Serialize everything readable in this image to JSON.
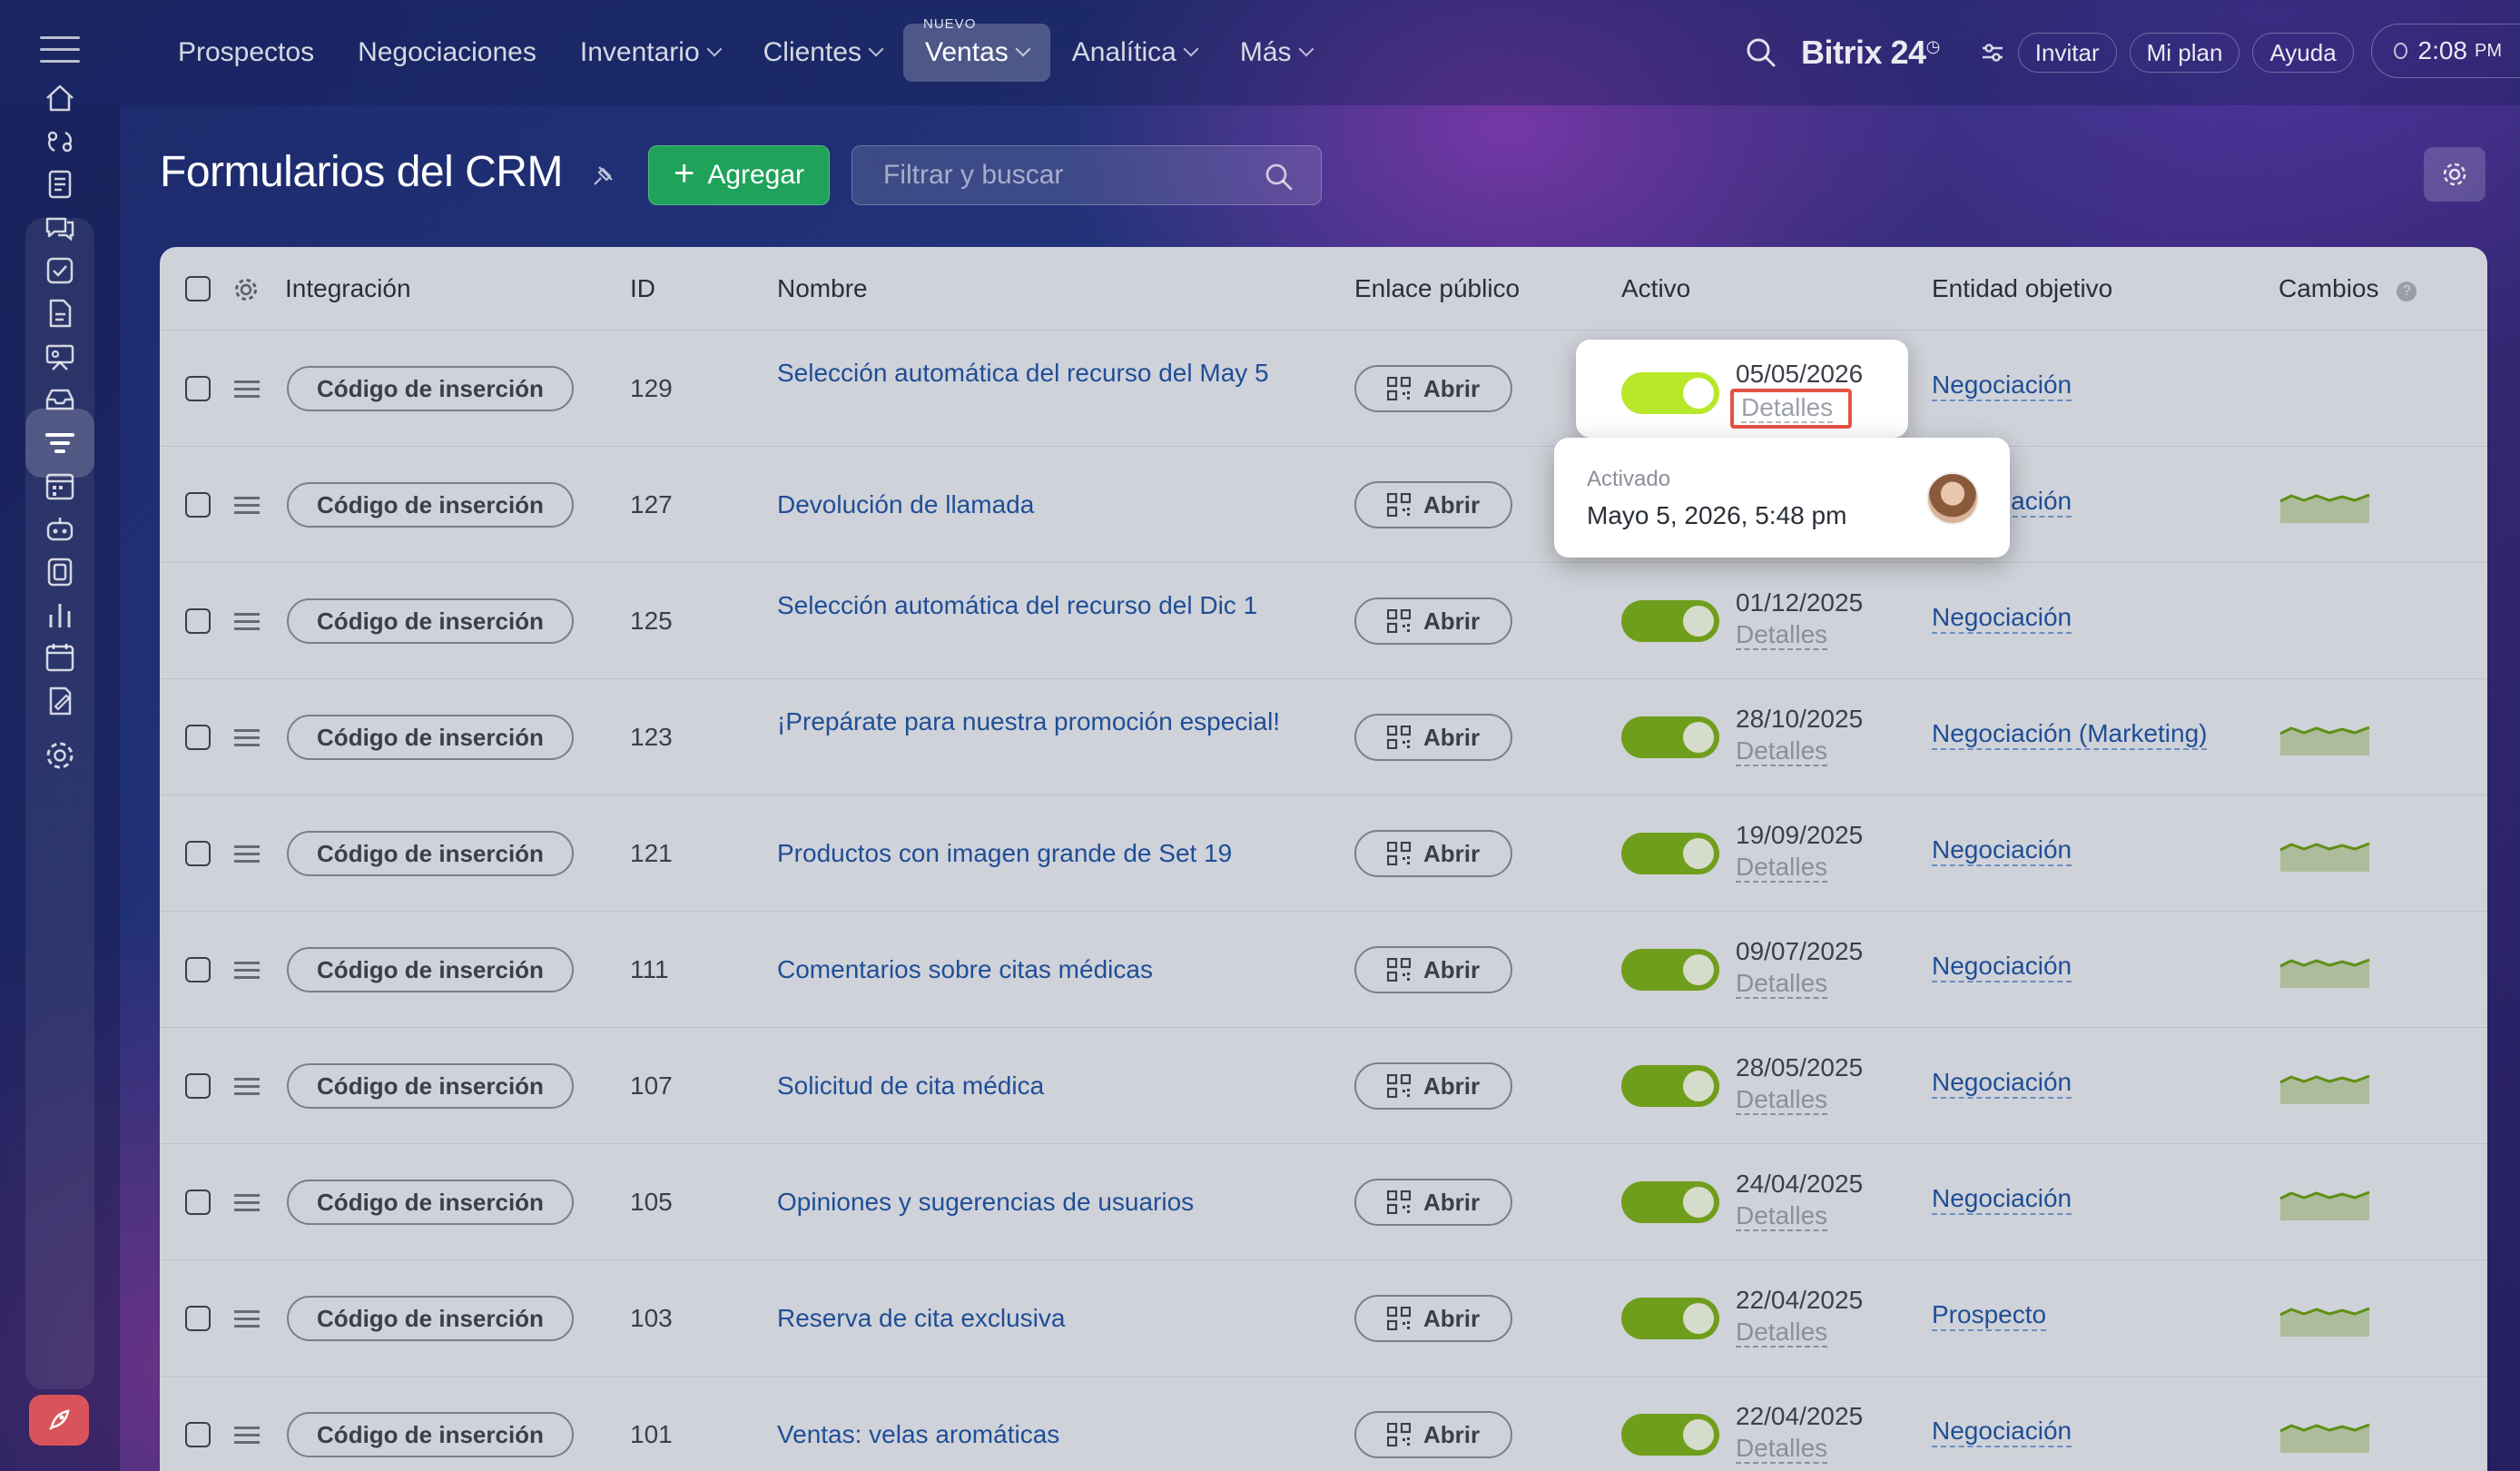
{
  "topnav": {
    "items": [
      {
        "label": "Prospectos",
        "dropdown": false
      },
      {
        "label": "Negociaciones",
        "dropdown": false
      },
      {
        "label": "Inventario",
        "dropdown": true
      },
      {
        "label": "Clientes",
        "dropdown": true
      },
      {
        "label": "Ventas",
        "dropdown": true,
        "badge": "NUEVO",
        "active": true
      },
      {
        "label": "Analítica",
        "dropdown": true
      },
      {
        "label": "Más",
        "dropdown": true
      }
    ],
    "brand": "Bitrix 24",
    "invite": "Invitar",
    "plan": "Mi plan",
    "help": "Ayuda",
    "time": "2:08",
    "ampm": "PM"
  },
  "page": {
    "title": "Formularios del CRM",
    "add_label": "Agregar",
    "search_placeholder": "Filtrar y buscar"
  },
  "table": {
    "columns": {
      "integration": "Integración",
      "id": "ID",
      "name": "Nombre",
      "public_link": "Enlace público",
      "active": "Activo",
      "entity": "Entidad objetivo",
      "changes": "Cambios"
    },
    "chip_label": "Código de inserción",
    "open_label": "Abrir",
    "details_label": "Detalles",
    "rows": [
      {
        "id": "129",
        "name": "Selección automática del recurso del May 5",
        "date": "05/05/2026",
        "entity": "Negociación",
        "has_chart": false
      },
      {
        "id": "127",
        "name": "Devolución de llamada",
        "date": "",
        "entity": "Negociación",
        "has_chart": true
      },
      {
        "id": "125",
        "name": "Selección automática del recurso del Dic 1",
        "date": "01/12/2025",
        "entity": "Negociación",
        "has_chart": false
      },
      {
        "id": "123",
        "name": "¡Prepárate para nuestra promoción especial!",
        "date": "28/10/2025",
        "entity": "Negociación (Marketing)",
        "has_chart": true
      },
      {
        "id": "121",
        "name": "Productos con imagen grande de Set 19",
        "date": "19/09/2025",
        "entity": "Negociación",
        "has_chart": true
      },
      {
        "id": "111",
        "name": "Comentarios sobre citas médicas",
        "date": "09/07/2025",
        "entity": "Negociación",
        "has_chart": true
      },
      {
        "id": "107",
        "name": "Solicitud de cita médica",
        "date": "28/05/2025",
        "entity": "Negociación",
        "has_chart": true
      },
      {
        "id": "105",
        "name": "Opiniones y sugerencias de usuarios",
        "date": "24/04/2025",
        "entity": "Negociación",
        "has_chart": true
      },
      {
        "id": "103",
        "name": "Reserva de cita exclusiva",
        "date": "22/04/2025",
        "entity": "Prospecto",
        "has_chart": true
      },
      {
        "id": "101",
        "name": "Ventas: velas aromáticas",
        "date": "22/04/2025",
        "entity": "Negociación",
        "has_chart": true
      }
    ]
  },
  "tooltip": {
    "label": "Activado",
    "value": "Mayo 5, 2026, 5:48 pm"
  },
  "colors": {
    "toggle_on": "#b7e82a",
    "highlight": "#e55446",
    "add_button": "#1fa35a",
    "link": "#1f4e96"
  }
}
